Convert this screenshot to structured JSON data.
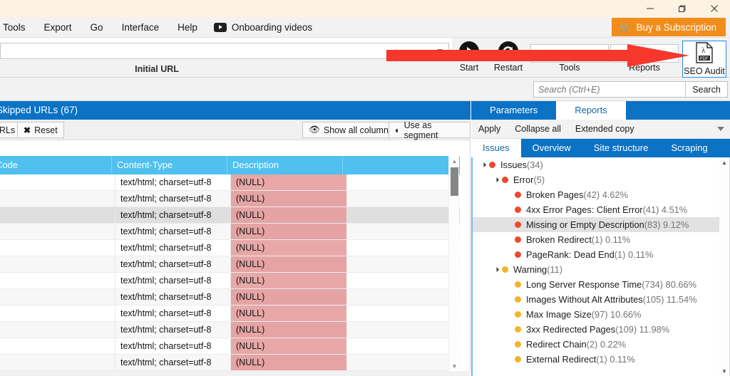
{
  "window": {
    "minimize_label": "minimize",
    "maximize_label": "restore",
    "close_label": "close"
  },
  "menubar": {
    "items": [
      {
        "label": "Tools"
      },
      {
        "label": "Export"
      },
      {
        "label": "Go"
      },
      {
        "label": "Interface"
      },
      {
        "label": "Help"
      }
    ],
    "video_label": "Onboarding videos",
    "buy_label": "Buy a Subscription"
  },
  "ribbon": {
    "initial_url_label": "Initial URL",
    "url_value": "",
    "tools": [
      {
        "label": "Start",
        "icon": "play-circle-icon"
      },
      {
        "label": "Restart",
        "icon": "restart-circle-icon"
      },
      {
        "label": "Tools",
        "icon": "tools-icon"
      },
      {
        "label": "Reports",
        "icon": "reports-icon"
      }
    ],
    "seo_audit_label": "SEO Audit",
    "seo_audit_icon": "pdf-icon"
  },
  "search": {
    "placeholder": "Search (Ctrl+E)",
    "value": "",
    "button_label": "Search"
  },
  "left_panel": {
    "header": "Skipped URLs (67)",
    "toolbar": {
      "urls_label": "RLs",
      "reset_label": "Reset",
      "show_all_columns_label": "Show all columns",
      "use_as_segment_label": "Use as segment"
    },
    "table": {
      "columns": [
        "Code",
        "Content-Type",
        "Description"
      ],
      "rows": [
        {
          "code": "",
          "content_type": "text/html; charset=utf-8",
          "description": "(NULL)"
        },
        {
          "code": "",
          "content_type": "text/html; charset=utf-8",
          "description": "(NULL)"
        },
        {
          "code": "",
          "content_type": "text/html; charset=utf-8",
          "description": "(NULL)"
        },
        {
          "code": "",
          "content_type": "text/html; charset=utf-8",
          "description": "(NULL)"
        },
        {
          "code": "",
          "content_type": "text/html; charset=utf-8",
          "description": "(NULL)"
        },
        {
          "code": "",
          "content_type": "text/html; charset=utf-8",
          "description": "(NULL)"
        },
        {
          "code": "",
          "content_type": "text/html; charset=utf-8",
          "description": "(NULL)"
        },
        {
          "code": "",
          "content_type": "text/html; charset=utf-8",
          "description": "(NULL)"
        },
        {
          "code": "",
          "content_type": "text/html; charset=utf-8",
          "description": "(NULL)"
        },
        {
          "code": "",
          "content_type": "text/html; charset=utf-8",
          "description": "(NULL)"
        },
        {
          "code": "",
          "content_type": "text/html; charset=utf-8",
          "description": "(NULL)"
        },
        {
          "code": "",
          "content_type": "text/html; charset=utf-8",
          "description": "(NULL)"
        }
      ],
      "selected_row_index": 2
    }
  },
  "right_panel": {
    "tabs": [
      {
        "label": "Parameters",
        "active": false
      },
      {
        "label": "Reports",
        "active": true
      }
    ],
    "toolbar": [
      {
        "label": "Apply"
      },
      {
        "label": "Collapse all"
      },
      {
        "label": "Extended copy"
      }
    ],
    "subtabs": [
      {
        "label": "Issues",
        "active": true
      },
      {
        "label": "Overview",
        "active": false
      },
      {
        "label": "Site structure",
        "active": false
      },
      {
        "label": "Scraping",
        "active": false
      }
    ],
    "tree": [
      {
        "depth": 0,
        "twisty": true,
        "severity": "red",
        "label": "Issues",
        "count": "(34)",
        "pct": "",
        "selected": false
      },
      {
        "depth": 1,
        "twisty": true,
        "severity": "red",
        "label": "Error",
        "count": "(5)",
        "pct": "",
        "selected": false
      },
      {
        "depth": 2,
        "twisty": false,
        "severity": "red",
        "label": "Broken Pages",
        "count": "(42)",
        "pct": "4.62%",
        "selected": false
      },
      {
        "depth": 2,
        "twisty": false,
        "severity": "red",
        "label": "4xx Error Pages: Client Error",
        "count": "(41)",
        "pct": "4.51%",
        "selected": false
      },
      {
        "depth": 2,
        "twisty": false,
        "severity": "red",
        "label": "Missing or Empty Description",
        "count": "(83)",
        "pct": "9.12%",
        "selected": true
      },
      {
        "depth": 2,
        "twisty": false,
        "severity": "red",
        "label": "Broken Redirect",
        "count": "(1)",
        "pct": "0.11%",
        "selected": false
      },
      {
        "depth": 2,
        "twisty": false,
        "severity": "red",
        "label": "PageRank: Dead End",
        "count": "(1)",
        "pct": "0.11%",
        "selected": false
      },
      {
        "depth": 1,
        "twisty": true,
        "severity": "yellow",
        "label": "Warning",
        "count": "(11)",
        "pct": "",
        "selected": false
      },
      {
        "depth": 2,
        "twisty": false,
        "severity": "yellow",
        "label": "Long Server Response Time",
        "count": "(734)",
        "pct": "80.66%",
        "selected": false
      },
      {
        "depth": 2,
        "twisty": false,
        "severity": "yellow",
        "label": "Images Without Alt Attributes",
        "count": "(105)",
        "pct": "11.54%",
        "selected": false
      },
      {
        "depth": 2,
        "twisty": false,
        "severity": "yellow",
        "label": "Max Image Size",
        "count": "(97)",
        "pct": "10.66%",
        "selected": false
      },
      {
        "depth": 2,
        "twisty": false,
        "severity": "yellow",
        "label": "3xx Redirected Pages",
        "count": "(109)",
        "pct": "11.98%",
        "selected": false
      },
      {
        "depth": 2,
        "twisty": false,
        "severity": "yellow",
        "label": "Redirect Chain",
        "count": "(2)",
        "pct": "0.22%",
        "selected": false
      },
      {
        "depth": 2,
        "twisty": false,
        "severity": "yellow",
        "label": "External Redirect",
        "count": "(1)",
        "pct": "0.11%",
        "selected": false
      }
    ]
  },
  "annotation": {
    "arrow_color": "#F5372C",
    "arrow_name": "red-pointer-arrow"
  },
  "colors": {
    "accent_blue": "#0b72c4",
    "header_blue": "#4fc0f0",
    "orange": "#f28d1b",
    "error_red": "#f0472c",
    "warning_yellow": "#f5b328",
    "null_cell": "#e8a8a8",
    "titlebar_cream": "#fcf3e3"
  }
}
